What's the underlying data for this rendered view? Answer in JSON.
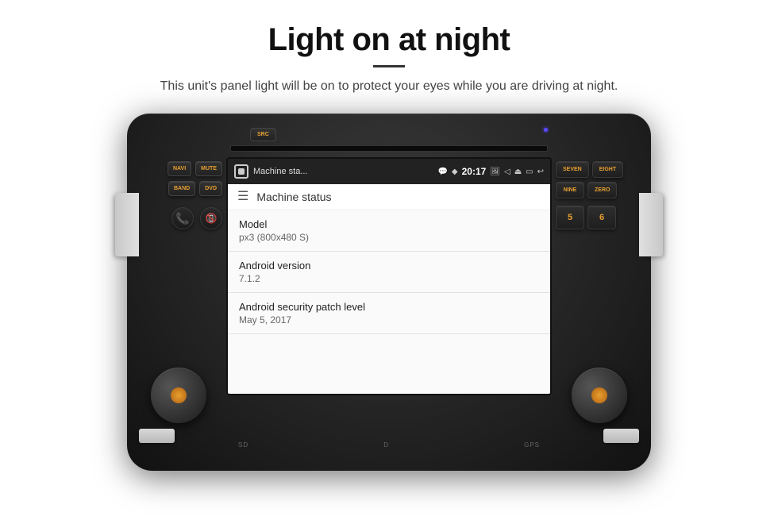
{
  "header": {
    "title": "Light on at night",
    "subtitle": "This unit's panel light will be on to protect your eyes while you are driving at night."
  },
  "device": {
    "statusbar": {
      "title": "Machine sta...",
      "chat_icon": "💬",
      "location_icon": "♦",
      "time": "20:17",
      "volume_icon": "◁",
      "eject_icon": "⏏",
      "screen_icon": "▭",
      "arrow_icon": "↩"
    },
    "toolbar": {
      "menu_icon": "☰",
      "title": "Machine status"
    },
    "info_items": [
      {
        "label": "Model",
        "value": "px3 (800x480 S)"
      },
      {
        "label": "Android version",
        "value": "7.1.2"
      },
      {
        "label": "Android security patch level",
        "value": "May 5, 2017"
      }
    ],
    "left_buttons": [
      {
        "label": "SRC",
        "top": true
      },
      {
        "label": "NAVI"
      },
      {
        "label": "MUTE"
      },
      {
        "label": "BAND"
      },
      {
        "label": "DVD"
      }
    ],
    "right_buttons": [
      {
        "label": "SEVEN"
      },
      {
        "label": "EIGHT"
      },
      {
        "label": "NINE"
      },
      {
        "label": "ZERO"
      }
    ],
    "sd_label_left": "SD",
    "d_label": "D",
    "gps_label": "GPS",
    "src_label": "SRC"
  }
}
